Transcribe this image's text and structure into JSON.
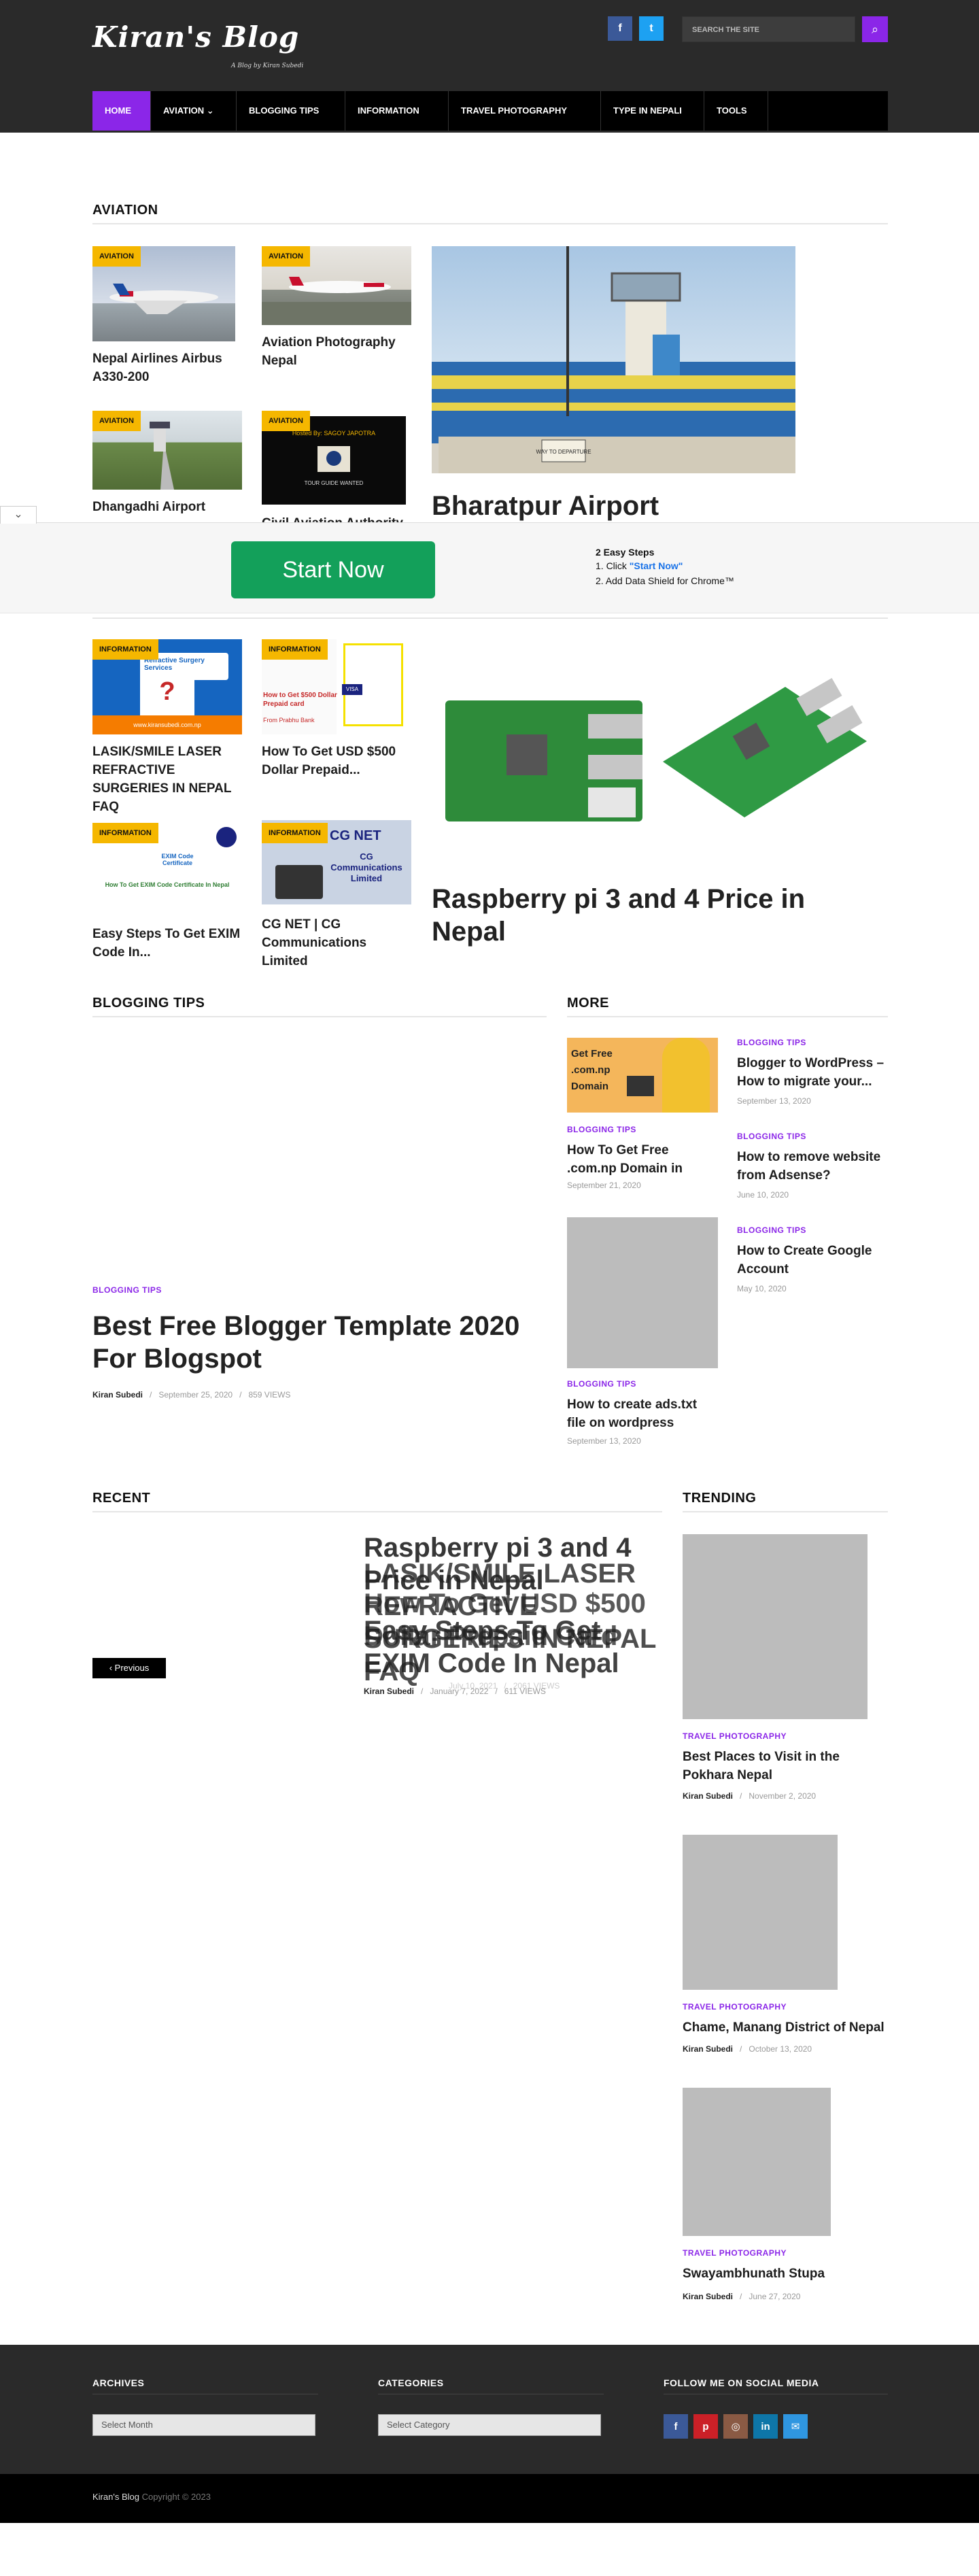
{
  "header": {
    "logo": "Kiran's Blog",
    "tagline": "A Blog by Kiran Subedi",
    "social": [
      {
        "icon": "facebook-icon",
        "glyph": "f",
        "color": "#3b5998"
      },
      {
        "icon": "twitter-icon",
        "glyph": "t",
        "color": "#1da1f2"
      }
    ],
    "search_placeholder": "SEARCH THE SITE"
  },
  "nav": [
    {
      "label": "HOME",
      "active": true
    },
    {
      "label": "AVIATION ⌄"
    },
    {
      "label": "BLOGGING TIPS"
    },
    {
      "label": "INFORMATION"
    },
    {
      "label": "TRAVEL PHOTOGRAPHY"
    },
    {
      "label": "TYPE IN NEPALI"
    },
    {
      "label": "TOOLS"
    }
  ],
  "aviation": {
    "title": "AVIATION",
    "badge": "AVIATION",
    "cards": [
      {
        "title": "Nepal Airlines Airbus A330-200"
      },
      {
        "title": "Aviation Photography Nepal"
      },
      {
        "title": "Dhangadhi Airport"
      },
      {
        "title": "Civil Aviation Authority"
      }
    ],
    "feature": "Bharatpur Airport",
    "feature_sign": "WAY TO DEPARTURE",
    "civil_img_text": "Hosted By: SAGOY JAPOTRA",
    "civil_img_sub": "TOUR GUIDE WANTED"
  },
  "ad": {
    "button": "Start Now",
    "steps_title": "2 Easy Steps",
    "step1_pre": "1. Click ",
    "step1_link": "\"Start Now\"",
    "step2": "2. Add Data Shield for Chrome™",
    "close": "⌄"
  },
  "information": {
    "badge": "INFORMATION",
    "cards": [
      {
        "title": "LASIK/SMILE LASER REFRACTIVE SURGERIES IN NEPAL FAQ",
        "img_text": "Refractive Surgery Services",
        "img_sub": "www.kiransubedi.com.np"
      },
      {
        "title": "How To Get USD $500 Dollar Prepaid...",
        "img_text": "How to Get $500 Dollar Prepaid card",
        "img_sub": "From Prabhu Bank"
      },
      {
        "title": "Easy Steps To Get EXIM Code In...",
        "img_text": "EXIM Code Certificate",
        "img_sub": "How To Get EXIM Code Certificate In Nepal"
      },
      {
        "title": "CG NET | CG Communications Limited",
        "img_text": "CG Communications Limited",
        "img_sub": "CG NET"
      }
    ],
    "feature": "Raspberry pi 3 and 4 Price in Nepal"
  },
  "blogging": {
    "title": "BLOGGING TIPS",
    "cat": "BLOGGING TIPS",
    "feature": "Best Free Blogger Template 2020 For Blogspot",
    "author": "Kiran Subedi",
    "date": "September 25, 2020",
    "views": "859 VIEWS"
  },
  "more": {
    "title": "MORE",
    "cat": "BLOGGING TIPS",
    "left": [
      {
        "title": "How To Get Free .com.np Domain in",
        "date": "September 21, 2020",
        "img_text": "Get Free .com.np Domain"
      },
      {
        "title": "How to create ads.txt file on wordpress",
        "date": "September 13, 2020"
      }
    ],
    "right": [
      {
        "title": "Blogger to WordPress – How to migrate your...",
        "date": "September 13, 2020"
      },
      {
        "title": "How to remove website from Adsense?",
        "date": "June 10, 2020"
      },
      {
        "title": "How to Create Google Account",
        "date": "May 10, 2020"
      }
    ]
  },
  "recent": {
    "title": "RECENT",
    "overlap_titles": [
      "Raspberry pi 3 and 4 Price in Nepal",
      "LASIK/SMILE LASER REFRACTIVE SURGERIES IN NEPAL FAQ",
      "How To Get USD $500 Dollar Prepaid Card",
      "Easy Steps To Get EXIM Code In Nepal"
    ],
    "author": "Kiran Subedi",
    "date": "July 10, 2021",
    "date2": "January 7, 2022",
    "views": "2061 VIEWS",
    "views2": "611 VIEWS",
    "prev": "‹ Previous"
  },
  "trending": {
    "title": "TRENDING",
    "cat": "TRAVEL PHOTOGRAPHY",
    "author": "Kiran Subedi",
    "items": [
      {
        "title": "Best Places to Visit in the Pokhara Nepal",
        "date": "November 2, 2020"
      },
      {
        "title": "Chame, Manang District of Nepal",
        "date": "October 13, 2020"
      },
      {
        "title": "Swayambhunath Stupa",
        "date": "June 27, 2020"
      }
    ]
  },
  "footer": {
    "archives": "ARCHIVES",
    "archives_select": "Select Month",
    "categories": "CATEGORIES",
    "categories_select": "Select Category",
    "follow": "FOLLOW ME ON SOCIAL MEDIA",
    "social": [
      {
        "icon": "facebook-icon",
        "glyph": "f",
        "color": "#3b5998"
      },
      {
        "icon": "pinterest-icon",
        "glyph": "p",
        "color": "#cb2027"
      },
      {
        "icon": "instagram-icon",
        "glyph": "◎",
        "color": "#8a5a44"
      },
      {
        "icon": "linkedin-icon",
        "glyph": "in",
        "color": "#0e76a8"
      },
      {
        "icon": "email-icon",
        "glyph": "✉",
        "color": "#2f96e0"
      }
    ],
    "copyright_brand": "Kiran's Blog",
    "copyright_text": " Copyright © 2023"
  }
}
